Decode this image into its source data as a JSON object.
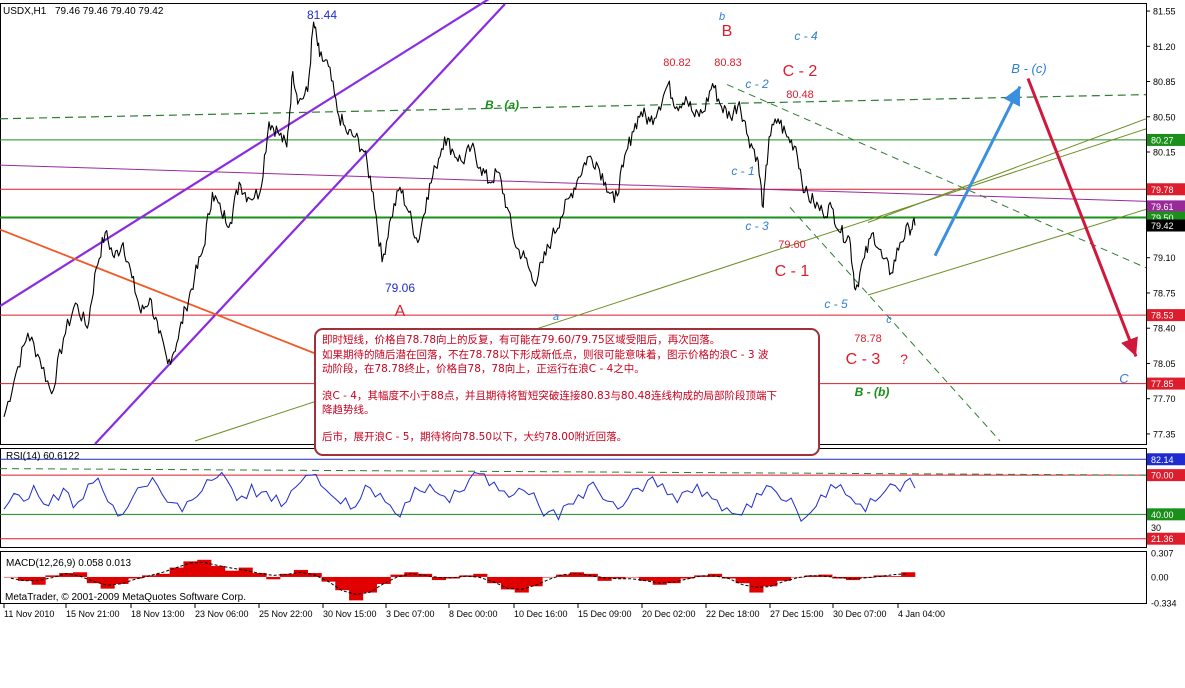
{
  "header": {
    "symbol": "USDX,H1",
    "ohlc": "79.46 79.46 79.40 79.42",
    "rsi_label": "RSI(14) 60.6122",
    "macd_label": "MACD(12,26,9) 0.058 0.013",
    "copyright": "MetaTrader, © 2001-2009 MetaQuotes Software Corp."
  },
  "note": {
    "lines": [
      "即时短线，价格自78.78向上的反复，有可能在79.60/79.75区域受阻后，再次回落。",
      "如果期待的随后潜在回落，不在78.78以下形成新低点，则很可能意味着，图示价格的浪C - 3 波",
      "动阶段，在78.78终止，价格自78，78向上，正运行在浪C - 4之中。",
      "",
      "浪C - 4，其幅度不小于88点，并且期待将暂短突破连接80.83与80.48连线构成的局部阶段顶端下",
      "降趋势线。",
      "",
      "后市，展开浪C - 5，期待将向78.50以下，大约78.00附近回落。"
    ]
  },
  "chart_data": [
    {
      "type": "line",
      "title": "USDX,H1",
      "subtitle": "79.46 79.46 79.40 79.42",
      "ylim": [
        77.25,
        81.62
      ],
      "price_axis_ticks": [
        "81.55",
        "81.20",
        "80.85",
        "80.50",
        "80.15",
        "79.80",
        "79.45",
        "79.10",
        "78.75",
        "78.40",
        "78.05",
        "77.70",
        "77.35"
      ],
      "x_tick_labels": [
        "11 Nov 2010",
        "15 Nov 21:00",
        "18 Nov 13:00",
        "23 Nov 06:00",
        "25 Nov 22:00",
        "30 Nov 15:00",
        "3 Dec 07:00",
        "8 Dec 00:00",
        "10 Dec 16:00",
        "15 Dec 09:00",
        "20 Dec 02:00",
        "22 Dec 18:00",
        "27 Dec 15:00",
        "30 Dec 07:00",
        "4 Jan 04:00"
      ],
      "price_series": [
        {
          "x": 0,
          "y": 77.52
        },
        {
          "x": 2,
          "y": 77.95
        },
        {
          "x": 4,
          "y": 78.35
        },
        {
          "x": 6,
          "y": 78.1
        },
        {
          "x": 8,
          "y": 77.75
        },
        {
          "x": 10,
          "y": 78.3
        },
        {
          "x": 12,
          "y": 78.65
        },
        {
          "x": 14,
          "y": 78.4
        },
        {
          "x": 15.5,
          "y": 79.0
        },
        {
          "x": 17,
          "y": 79.35
        },
        {
          "x": 18.5,
          "y": 79.1
        },
        {
          "x": 20,
          "y": 79.25
        },
        {
          "x": 21.5,
          "y": 78.9
        },
        {
          "x": 23,
          "y": 78.55
        },
        {
          "x": 24.5,
          "y": 78.7
        },
        {
          "x": 26,
          "y": 78.35
        },
        {
          "x": 27.5,
          "y": 78.05
        },
        {
          "x": 29,
          "y": 78.25
        },
        {
          "x": 30.5,
          "y": 78.6
        },
        {
          "x": 32,
          "y": 78.9
        },
        {
          "x": 33.5,
          "y": 79.2
        },
        {
          "x": 35,
          "y": 79.75
        },
        {
          "x": 36.5,
          "y": 79.55
        },
        {
          "x": 38,
          "y": 79.45
        },
        {
          "x": 39.5,
          "y": 79.85
        },
        {
          "x": 41,
          "y": 79.7
        },
        {
          "x": 43,
          "y": 79.75
        },
        {
          "x": 44.5,
          "y": 80.45
        },
        {
          "x": 46,
          "y": 80.35
        },
        {
          "x": 47.5,
          "y": 80.2
        },
        {
          "x": 48.5,
          "y": 80.95
        },
        {
          "x": 49.5,
          "y": 80.65
        },
        {
          "x": 51,
          "y": 80.75
        },
        {
          "x": 52,
          "y": 81.44
        },
        {
          "x": 53,
          "y": 81.1
        },
        {
          "x": 54.5,
          "y": 81.0
        },
        {
          "x": 56,
          "y": 80.55
        },
        {
          "x": 57.5,
          "y": 80.35
        },
        {
          "x": 59,
          "y": 80.3
        },
        {
          "x": 60.5,
          "y": 80.15
        },
        {
          "x": 62,
          "y": 79.75
        },
        {
          "x": 63.5,
          "y": 79.06
        },
        {
          "x": 65,
          "y": 79.5
        },
        {
          "x": 66.5,
          "y": 79.8
        },
        {
          "x": 68,
          "y": 79.55
        },
        {
          "x": 69.5,
          "y": 79.25
        },
        {
          "x": 71,
          "y": 79.7
        },
        {
          "x": 72.5,
          "y": 80.0
        },
        {
          "x": 74,
          "y": 80.3
        },
        {
          "x": 75.5,
          "y": 80.15
        },
        {
          "x": 77,
          "y": 80.05
        },
        {
          "x": 78.5,
          "y": 80.2
        },
        {
          "x": 80,
          "y": 80.0
        },
        {
          "x": 81.5,
          "y": 79.85
        },
        {
          "x": 83,
          "y": 79.95
        },
        {
          "x": 84.5,
          "y": 79.6
        },
        {
          "x": 86,
          "y": 79.2
        },
        {
          "x": 87.5,
          "y": 79.1
        },
        {
          "x": 89,
          "y": 78.85
        },
        {
          "x": 90.5,
          "y": 79.05
        },
        {
          "x": 92,
          "y": 79.3
        },
        {
          "x": 93.5,
          "y": 79.5
        },
        {
          "x": 95,
          "y": 79.7
        },
        {
          "x": 96.5,
          "y": 79.9
        },
        {
          "x": 98,
          "y": 80.1
        },
        {
          "x": 99.5,
          "y": 80.05
        },
        {
          "x": 101,
          "y": 79.85
        },
        {
          "x": 102.5,
          "y": 79.65
        },
        {
          "x": 104,
          "y": 80.0
        },
        {
          "x": 105.5,
          "y": 80.35
        },
        {
          "x": 107,
          "y": 80.55
        },
        {
          "x": 108.5,
          "y": 80.45
        },
        {
          "x": 110,
          "y": 80.6
        },
        {
          "x": 111.5,
          "y": 80.82
        },
        {
          "x": 113,
          "y": 80.6
        },
        {
          "x": 114.5,
          "y": 80.7
        },
        {
          "x": 116,
          "y": 80.5
        },
        {
          "x": 117.5,
          "y": 80.55
        },
        {
          "x": 119,
          "y": 80.83
        },
        {
          "x": 120.5,
          "y": 80.6
        },
        {
          "x": 122,
          "y": 80.5
        },
        {
          "x": 123.5,
          "y": 80.65
        },
        {
          "x": 125,
          "y": 80.3
        },
        {
          "x": 126.5,
          "y": 80.1
        },
        {
          "x": 127.5,
          "y": 79.6
        },
        {
          "x": 128.5,
          "y": 80.3
        },
        {
          "x": 130,
          "y": 80.48
        },
        {
          "x": 131.5,
          "y": 80.3
        },
        {
          "x": 133,
          "y": 80.2
        },
        {
          "x": 134.5,
          "y": 79.75
        },
        {
          "x": 136,
          "y": 79.65
        },
        {
          "x": 137.5,
          "y": 79.55
        },
        {
          "x": 139,
          "y": 79.6
        },
        {
          "x": 140.5,
          "y": 79.35
        },
        {
          "x": 142,
          "y": 79.3
        },
        {
          "x": 143,
          "y": 78.78
        },
        {
          "x": 144.5,
          "y": 79.1
        },
        {
          "x": 146,
          "y": 79.35
        },
        {
          "x": 147.5,
          "y": 79.1
        },
        {
          "x": 149,
          "y": 78.95
        },
        {
          "x": 150.5,
          "y": 79.25
        },
        {
          "x": 152,
          "y": 79.4
        },
        {
          "x": 153,
          "y": 79.42
        }
      ],
      "horizontal_levels": [
        {
          "label": "80.27",
          "color": "#1a8f1a"
        },
        {
          "label": "79.78",
          "color": "#dd1c2c"
        },
        {
          "label": "79.61",
          "color": "#9a2a9a"
        },
        {
          "label": "79.50",
          "color": "#1a8f1a"
        },
        {
          "label": "79.42",
          "color": "#000000"
        },
        {
          "label": "78.53",
          "color": "#dd1c2c"
        },
        {
          "label": "77.85",
          "color": "#dd1c2c"
        }
      ],
      "annotations": {
        "red": [
          "B",
          "C - 2",
          "C - 1",
          "A",
          "C - 3",
          "?",
          "80.82",
          "80.83",
          "80.48",
          "79.60",
          "78.78"
        ],
        "blue": [
          "81.44",
          "79.06",
          "b",
          "c - 4",
          "c - 2",
          "c - 1",
          "c - 3",
          "c - 5",
          "c",
          "a",
          "B - (c)",
          "C"
        ],
        "green": [
          "B - (a)",
          "B - (b)"
        ]
      },
      "colors": {
        "up_arrow": "#3a8fe0",
        "down_arrow": "#d0183c",
        "channel": "#8a2be2",
        "trend_red": "#f05a28",
        "trend_green": "#2e7d32",
        "trend_olive": "#6b8e23"
      }
    },
    {
      "type": "line",
      "title": "RSI(14) 60.6122",
      "ylim": [
        15,
        90
      ],
      "levels": [
        {
          "label": "82.14",
          "color": "#1f2bd0"
        },
        {
          "label": "70.00",
          "color": "#dd1c2c"
        },
        {
          "label": "40.00",
          "color": "#1a8f1a"
        },
        {
          "label": "30",
          "color": "#888888"
        },
        {
          "label": "21.36",
          "color": "#dd1c2c"
        }
      ],
      "series": [
        {
          "values": [
            44,
            56,
            50,
            62,
            48,
            55,
            60,
            45,
            52,
            64,
            58,
            47,
            40,
            53,
            61,
            68,
            55,
            49,
            42,
            51,
            58,
            66,
            72,
            60,
            54,
            63,
            57,
            50,
            46,
            58,
            65,
            70,
            62,
            55,
            48,
            44,
            52,
            60,
            56,
            47,
            38,
            50,
            58,
            63,
            55,
            49,
            57,
            67,
            71,
            62,
            58,
            53,
            60,
            55,
            47,
            42,
            36,
            48,
            55,
            62,
            58,
            50,
            44,
            52,
            60,
            66,
            61,
            55,
            49,
            58,
            63,
            57,
            51,
            45,
            40,
            48,
            56,
            62,
            57,
            50,
            44,
            38,
            46,
            53,
            60,
            55,
            48,
            42,
            50,
            58,
            62,
            65,
            60
          ]
        }
      ]
    },
    {
      "type": "bar",
      "title": "MACD(12,26,9) 0.058 0.013",
      "ylim": [
        -0.334,
        0.307
      ],
      "y_tick_labels": [
        "0.307",
        "0.00",
        "-0.334"
      ],
      "values": [
        0.0,
        -0.05,
        -0.1,
        0.02,
        0.05,
        0.06,
        -0.08,
        -0.15,
        -0.09,
        -0.02,
        0.02,
        0.04,
        0.12,
        0.2,
        0.22,
        0.14,
        0.08,
        0.12,
        0.05,
        -0.03,
        0.04,
        0.09,
        0.05,
        -0.06,
        -0.17,
        -0.3,
        -0.2,
        -0.09,
        0.03,
        0.06,
        0.04,
        -0.04,
        -0.02,
        0.02,
        0.04,
        -0.08,
        -0.16,
        -0.2,
        -0.12,
        0.0,
        0.03,
        0.06,
        0.04,
        -0.05,
        -0.02,
        0.0,
        -0.05,
        -0.1,
        -0.08,
        -0.02,
        0.02,
        0.04,
        -0.02,
        -0.08,
        -0.2,
        -0.12,
        -0.05,
        0.0,
        0.02,
        0.03,
        -0.02,
        -0.04,
        -0.01,
        0.02,
        0.01,
        0.06
      ]
    }
  ]
}
